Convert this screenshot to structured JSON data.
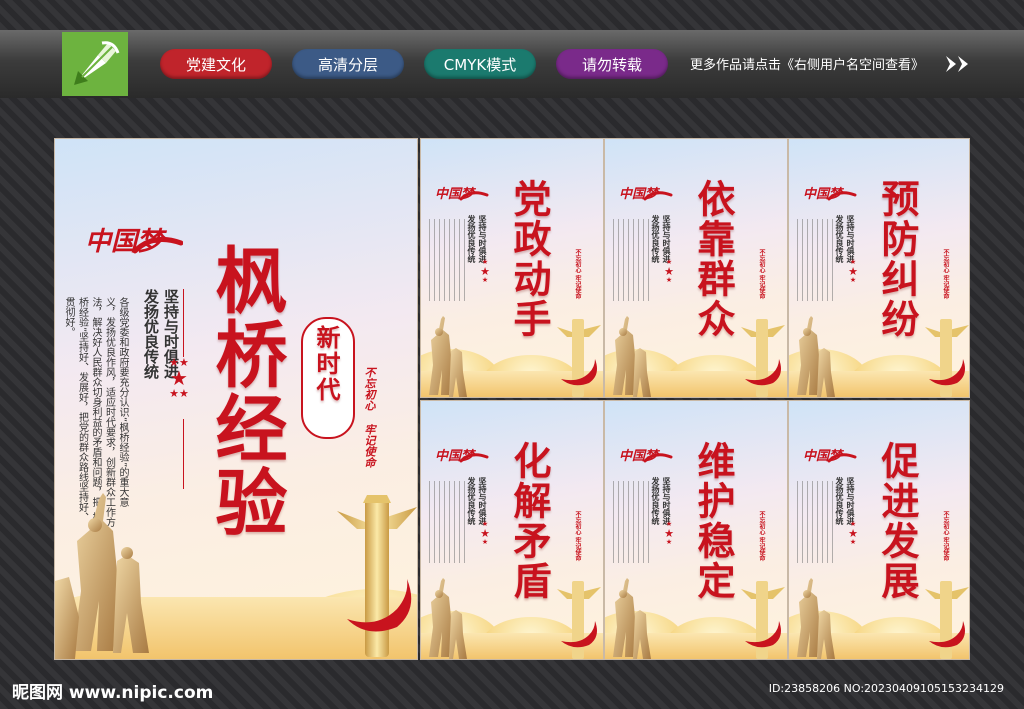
{
  "header": {
    "pills": [
      {
        "label": "党建文化",
        "color": "#c0242b"
      },
      {
        "label": "高清分层",
        "color": "#3c5a86"
      },
      {
        "label": "CMYK模式",
        "color": "#1b7a6e"
      },
      {
        "label": "请勿转载",
        "color": "#7a2a8a"
      }
    ],
    "more_text": "更多作品请点击《右侧用户名空间查看》"
  },
  "footer": {
    "site": "昵图网 www.nipic.com",
    "id_text": "ID:23858206 NO:20230409105153234129"
  },
  "main_poster": {
    "brand": "中国梦",
    "title": "枫桥经验",
    "badge": "新时代",
    "subtitle_a": "发扬优良传统",
    "subtitle_b": "坚持与时俱进",
    "body": "各级党委和政府要充分认识“枫桥经验”的重大意义，发扬优良作风，适应时代要求，创新群众工作方法，解决好人民群众切身利益的矛盾和问题，把“枫桥经验”坚持好、发展好，把党的群众路线坚持好、贯彻好。",
    "slogan_a": "不忘初心",
    "slogan_b": "牢记使命"
  },
  "small_posters": [
    {
      "title": "党政动手"
    },
    {
      "title": "依靠群众"
    },
    {
      "title": "预防纠纷"
    },
    {
      "title": "化解矛盾"
    },
    {
      "title": "维护稳定"
    },
    {
      "title": "促进发展"
    }
  ],
  "small_common": {
    "brand": "中国梦",
    "subtitle_a": "发扬优良传统",
    "subtitle_b": "坚持与时俱进",
    "slogan": "不忘初心 牢记使命"
  },
  "colors": {
    "accent": "#c8131e",
    "logo_green": "#6db33f"
  }
}
